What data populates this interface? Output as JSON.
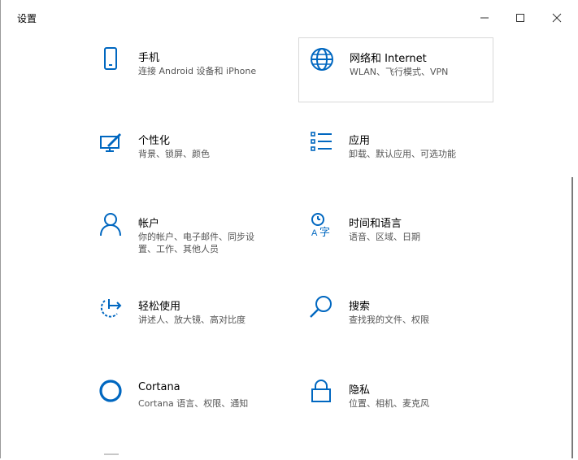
{
  "window": {
    "title": "设置",
    "controls": {
      "minimize": "—",
      "maximize": "☐",
      "close": "✕"
    }
  },
  "colors": {
    "accent": "#0067c0"
  },
  "tiles": [
    {
      "icon": "phone-icon",
      "title": "手机",
      "subtitle": "连接 Android 设备和 iPhone"
    },
    {
      "icon": "globe-icon",
      "title": "网络和 Internet",
      "subtitle": "WLAN、飞行模式、VPN"
    },
    {
      "icon": "personalization-icon",
      "title": "个性化",
      "subtitle": "背景、锁屏、颜色"
    },
    {
      "icon": "apps-list-icon",
      "title": "应用",
      "subtitle": "卸载、默认应用、可选功能"
    },
    {
      "icon": "person-icon",
      "title": "帐户",
      "subtitle": "你的帐户、电子邮件、同步设置、工作、其他人员"
    },
    {
      "icon": "time-language-icon",
      "title": "时间和语言",
      "subtitle": "语音、区域、日期"
    },
    {
      "icon": "ease-of-access-icon",
      "title": "轻松使用",
      "subtitle": "讲述人、放大镜、高对比度"
    },
    {
      "icon": "search-icon",
      "title": "搜索",
      "subtitle": "查找我的文件、权限"
    },
    {
      "icon": "cortana-icon",
      "title": "Cortana",
      "subtitle": "Cortana 语言、权限、通知"
    },
    {
      "icon": "lock-icon",
      "title": "隐私",
      "subtitle": "位置、相机、麦克风"
    }
  ]
}
